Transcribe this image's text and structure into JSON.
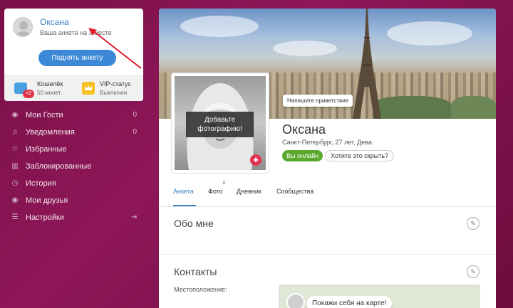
{
  "mini_card": {
    "name": "Оксана",
    "status": "Ваша анкета на 3 месте",
    "raise_button": "Поднять анкету",
    "wallet": {
      "title": "Кошелёк",
      "subtitle": "50 монет",
      "badge": "×2"
    },
    "vip": {
      "title": "VIP-статус",
      "subtitle": "Выключен"
    }
  },
  "menu": {
    "items": [
      {
        "icon": "eye-icon",
        "label": "Мои Гости",
        "count": "0"
      },
      {
        "icon": "bell-icon",
        "label": "Уведомления",
        "count": "0"
      },
      {
        "icon": "star-icon",
        "label": "Избранные",
        "count": ""
      },
      {
        "icon": "trash-icon",
        "label": "Заблокированные",
        "count": ""
      },
      {
        "icon": "history-icon",
        "label": "История",
        "count": ""
      },
      {
        "icon": "friends-icon",
        "label": "Мои друзья",
        "count": ""
      },
      {
        "icon": "settings-icon",
        "label": "Настройки",
        "count": ""
      }
    ]
  },
  "profile": {
    "greeting_button": "Напишите приветствие",
    "add_photo": "Добавьте фотографию!",
    "name": "Оксана",
    "info": "Санкт-Петербург, 27 лет, Дева",
    "online_badge": "Вы онлайн",
    "hide_button": "Хотите это скрыть?",
    "tabs": [
      {
        "label": "Анкета",
        "active": true
      },
      {
        "label": "Фото",
        "count": "0"
      },
      {
        "label": "Дневник"
      },
      {
        "label": "Сообщества"
      }
    ],
    "about_title": "Обо мне",
    "contacts_title": "Контакты",
    "location_label": "Местоположение:",
    "map_cta": "Покажи себя на карте!"
  },
  "colors": {
    "accent": "#3c88d6",
    "online": "#5aa82e",
    "background": "#7a1048",
    "alert": "#e0334c"
  }
}
